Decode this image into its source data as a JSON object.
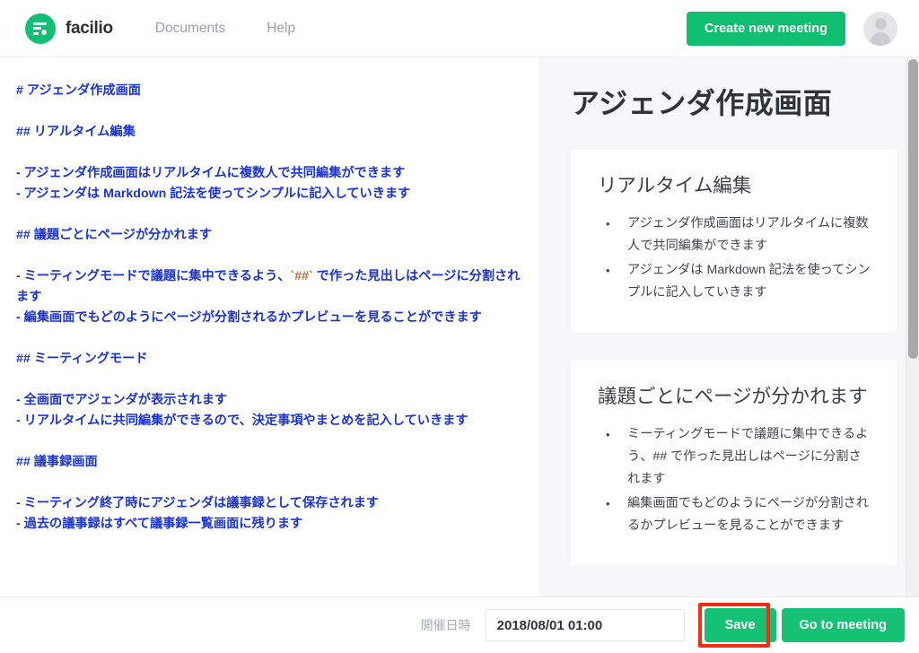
{
  "header": {
    "logo_icon": "facilio-logo-icon",
    "brand": "facilio",
    "nav": [
      {
        "label": "Documents"
      },
      {
        "label": "Help"
      }
    ],
    "create_button": "Create new meeting",
    "avatar_icon": "user-avatar-icon",
    "accent_color": "#0fbf6f"
  },
  "editor": {
    "lines": [
      {
        "text": "# アジェンダ作成画面"
      },
      {
        "text": ""
      },
      {
        "text": "## リアルタイム編集"
      },
      {
        "text": ""
      },
      {
        "text": "- アジェンダ作成画面はリアルタイムに複数人で共同編集ができます"
      },
      {
        "text": "- アジェンダは Markdown 記法を使ってシンプルに記入していきます"
      },
      {
        "text": ""
      },
      {
        "text": "## 議題ごとにページが分かれます"
      },
      {
        "text": ""
      },
      {
        "text": "- ミーティングモードで議題に集中できるよう、`##` で作った見出しはページに分割されます"
      },
      {
        "text": "- 編集画面でもどのようにページが分割されるかプレビューを見ることができます"
      },
      {
        "text": ""
      },
      {
        "text": "## ミーティングモード"
      },
      {
        "text": ""
      },
      {
        "text": "- 全画面でアジェンダが表示されます"
      },
      {
        "text": "- リアルタイムに共同編集ができるので、決定事項やまとめを記入していきます"
      },
      {
        "text": ""
      },
      {
        "text": "## 議事録画面"
      },
      {
        "text": ""
      },
      {
        "text": "- ミーティング終了時にアジェンダは議事録として保存されます"
      },
      {
        "text": "- 過去の議事録はすべて議事録一覧画面に残ります"
      }
    ],
    "text_color": "#1a33d8",
    "code_color": "#d2691e"
  },
  "preview": {
    "title": "アジェンダ作成画面",
    "cards": [
      {
        "title": "リアルタイム編集",
        "items": [
          "アジェンダ作成画面はリアルタイムに複数人で共同編集ができます",
          "アジェンダは Markdown 記法を使ってシンプルに記入していきます"
        ]
      },
      {
        "title": "議題ごとにページが分かれます",
        "items": [
          "ミーティングモードで議題に集中できるよう、## で作った見出しはページに分割されます",
          "編集画面でもどのようにページが分割されるかプレビューを見ることができます"
        ]
      }
    ]
  },
  "footer": {
    "date_label": "開催日時",
    "date_value": "2018/08/01 01:00",
    "save_label": "Save",
    "goto_label": "Go to meeting",
    "button_color": "#15c173",
    "highlight_color": "#fb2b10"
  }
}
